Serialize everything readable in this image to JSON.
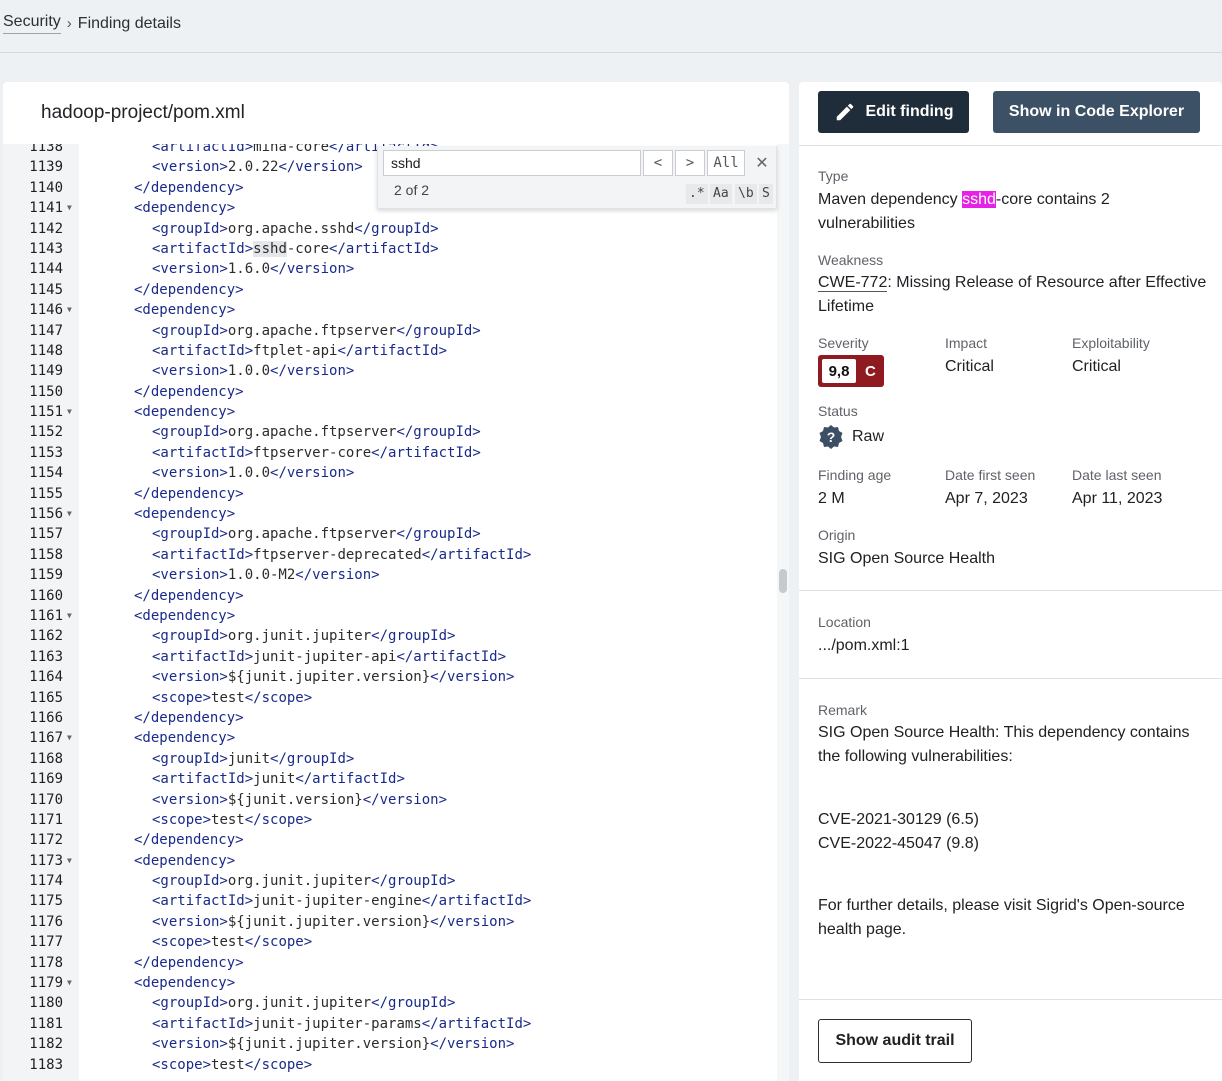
{
  "breadcrumb": {
    "parent": "Security",
    "current": "Finding details"
  },
  "file": {
    "path": "hadoop-project/pom.xml"
  },
  "search": {
    "query": "sshd",
    "prev_glyph": "<",
    "next_glyph": ">",
    "all_label": "All",
    "close_glyph": "✕",
    "match_count": "2 of 2",
    "opt_regex": ".*",
    "opt_case": "Aa",
    "opt_word": "\\b",
    "opt_selection": "S"
  },
  "code_lines": [
    {
      "n": "1138",
      "fold": false,
      "indent": 2,
      "parts": [
        [
          "tag",
          "<artifactId>"
        ],
        [
          "txt",
          "mina-core"
        ],
        [
          "tag",
          "</artifactId>"
        ]
      ]
    },
    {
      "n": "1139",
      "fold": false,
      "indent": 2,
      "parts": [
        [
          "tag",
          "<version>"
        ],
        [
          "txt",
          "2.0.22"
        ],
        [
          "tag",
          "</version>"
        ]
      ]
    },
    {
      "n": "1140",
      "fold": false,
      "indent": 1,
      "parts": [
        [
          "tag",
          "</dependency>"
        ]
      ]
    },
    {
      "n": "1141",
      "fold": true,
      "indent": 1,
      "parts": [
        [
          "tag",
          "<dependency>"
        ]
      ]
    },
    {
      "n": "1142",
      "fold": false,
      "indent": 2,
      "parts": [
        [
          "tag",
          "<groupId>"
        ],
        [
          "txt",
          "org.apache.sshd"
        ],
        [
          "tag",
          "</groupId>"
        ]
      ]
    },
    {
      "n": "1143",
      "fold": false,
      "indent": 2,
      "parts": [
        [
          "tag",
          "<artifactId>"
        ],
        [
          "hl",
          "sshd"
        ],
        [
          "txt",
          "-core"
        ],
        [
          "tag",
          "</artifactId>"
        ]
      ]
    },
    {
      "n": "1144",
      "fold": false,
      "indent": 2,
      "parts": [
        [
          "tag",
          "<version>"
        ],
        [
          "txt",
          "1.6.0"
        ],
        [
          "tag",
          "</version>"
        ]
      ]
    },
    {
      "n": "1145",
      "fold": false,
      "indent": 1,
      "parts": [
        [
          "tag",
          "</dependency>"
        ]
      ]
    },
    {
      "n": "1146",
      "fold": true,
      "indent": 1,
      "parts": [
        [
          "tag",
          "<dependency>"
        ]
      ]
    },
    {
      "n": "1147",
      "fold": false,
      "indent": 2,
      "parts": [
        [
          "tag",
          "<groupId>"
        ],
        [
          "txt",
          "org.apache.ftpserver"
        ],
        [
          "tag",
          "</groupId>"
        ]
      ]
    },
    {
      "n": "1148",
      "fold": false,
      "indent": 2,
      "parts": [
        [
          "tag",
          "<artifactId>"
        ],
        [
          "txt",
          "ftplet-api"
        ],
        [
          "tag",
          "</artifactId>"
        ]
      ]
    },
    {
      "n": "1149",
      "fold": false,
      "indent": 2,
      "parts": [
        [
          "tag",
          "<version>"
        ],
        [
          "txt",
          "1.0.0"
        ],
        [
          "tag",
          "</version>"
        ]
      ]
    },
    {
      "n": "1150",
      "fold": false,
      "indent": 1,
      "parts": [
        [
          "tag",
          "</dependency>"
        ]
      ]
    },
    {
      "n": "1151",
      "fold": true,
      "indent": 1,
      "parts": [
        [
          "tag",
          "<dependency>"
        ]
      ]
    },
    {
      "n": "1152",
      "fold": false,
      "indent": 2,
      "parts": [
        [
          "tag",
          "<groupId>"
        ],
        [
          "txt",
          "org.apache.ftpserver"
        ],
        [
          "tag",
          "</groupId>"
        ]
      ]
    },
    {
      "n": "1153",
      "fold": false,
      "indent": 2,
      "parts": [
        [
          "tag",
          "<artifactId>"
        ],
        [
          "txt",
          "ftpserver-core"
        ],
        [
          "tag",
          "</artifactId>"
        ]
      ]
    },
    {
      "n": "1154",
      "fold": false,
      "indent": 2,
      "parts": [
        [
          "tag",
          "<version>"
        ],
        [
          "txt",
          "1.0.0"
        ],
        [
          "tag",
          "</version>"
        ]
      ]
    },
    {
      "n": "1155",
      "fold": false,
      "indent": 1,
      "parts": [
        [
          "tag",
          "</dependency>"
        ]
      ]
    },
    {
      "n": "1156",
      "fold": true,
      "indent": 1,
      "parts": [
        [
          "tag",
          "<dependency>"
        ]
      ]
    },
    {
      "n": "1157",
      "fold": false,
      "indent": 2,
      "parts": [
        [
          "tag",
          "<groupId>"
        ],
        [
          "txt",
          "org.apache.ftpserver"
        ],
        [
          "tag",
          "</groupId>"
        ]
      ]
    },
    {
      "n": "1158",
      "fold": false,
      "indent": 2,
      "parts": [
        [
          "tag",
          "<artifactId>"
        ],
        [
          "txt",
          "ftpserver-deprecated"
        ],
        [
          "tag",
          "</artifactId>"
        ]
      ]
    },
    {
      "n": "1159",
      "fold": false,
      "indent": 2,
      "parts": [
        [
          "tag",
          "<version>"
        ],
        [
          "txt",
          "1.0.0-M2"
        ],
        [
          "tag",
          "</version>"
        ]
      ]
    },
    {
      "n": "1160",
      "fold": false,
      "indent": 1,
      "parts": [
        [
          "tag",
          "</dependency>"
        ]
      ]
    },
    {
      "n": "1161",
      "fold": true,
      "indent": 1,
      "parts": [
        [
          "tag",
          "<dependency>"
        ]
      ]
    },
    {
      "n": "1162",
      "fold": false,
      "indent": 2,
      "parts": [
        [
          "tag",
          "<groupId>"
        ],
        [
          "txt",
          "org.junit.jupiter"
        ],
        [
          "tag",
          "</groupId>"
        ]
      ]
    },
    {
      "n": "1163",
      "fold": false,
      "indent": 2,
      "parts": [
        [
          "tag",
          "<artifactId>"
        ],
        [
          "txt",
          "junit-jupiter-api"
        ],
        [
          "tag",
          "</artifactId>"
        ]
      ]
    },
    {
      "n": "1164",
      "fold": false,
      "indent": 2,
      "parts": [
        [
          "tag",
          "<version>"
        ],
        [
          "txt",
          "${junit.jupiter.version}"
        ],
        [
          "tag",
          "</version>"
        ]
      ]
    },
    {
      "n": "1165",
      "fold": false,
      "indent": 2,
      "parts": [
        [
          "tag",
          "<scope>"
        ],
        [
          "txt",
          "test"
        ],
        [
          "tag",
          "</scope>"
        ]
      ]
    },
    {
      "n": "1166",
      "fold": false,
      "indent": 1,
      "parts": [
        [
          "tag",
          "</dependency>"
        ]
      ]
    },
    {
      "n": "1167",
      "fold": true,
      "indent": 1,
      "parts": [
        [
          "tag",
          "<dependency>"
        ]
      ]
    },
    {
      "n": "1168",
      "fold": false,
      "indent": 2,
      "parts": [
        [
          "tag",
          "<groupId>"
        ],
        [
          "txt",
          "junit"
        ],
        [
          "tag",
          "</groupId>"
        ]
      ]
    },
    {
      "n": "1169",
      "fold": false,
      "indent": 2,
      "parts": [
        [
          "tag",
          "<artifactId>"
        ],
        [
          "txt",
          "junit"
        ],
        [
          "tag",
          "</artifactId>"
        ]
      ]
    },
    {
      "n": "1170",
      "fold": false,
      "indent": 2,
      "parts": [
        [
          "tag",
          "<version>"
        ],
        [
          "txt",
          "${junit.version}"
        ],
        [
          "tag",
          "</version>"
        ]
      ]
    },
    {
      "n": "1171",
      "fold": false,
      "indent": 2,
      "parts": [
        [
          "tag",
          "<scope>"
        ],
        [
          "txt",
          "test"
        ],
        [
          "tag",
          "</scope>"
        ]
      ]
    },
    {
      "n": "1172",
      "fold": false,
      "indent": 1,
      "parts": [
        [
          "tag",
          "</dependency>"
        ]
      ]
    },
    {
      "n": "1173",
      "fold": true,
      "indent": 1,
      "parts": [
        [
          "tag",
          "<dependency>"
        ]
      ]
    },
    {
      "n": "1174",
      "fold": false,
      "indent": 2,
      "parts": [
        [
          "tag",
          "<groupId>"
        ],
        [
          "txt",
          "org.junit.jupiter"
        ],
        [
          "tag",
          "</groupId>"
        ]
      ]
    },
    {
      "n": "1175",
      "fold": false,
      "indent": 2,
      "parts": [
        [
          "tag",
          "<artifactId>"
        ],
        [
          "txt",
          "junit-jupiter-engine"
        ],
        [
          "tag",
          "</artifactId>"
        ]
      ]
    },
    {
      "n": "1176",
      "fold": false,
      "indent": 2,
      "parts": [
        [
          "tag",
          "<version>"
        ],
        [
          "txt",
          "${junit.jupiter.version}"
        ],
        [
          "tag",
          "</version>"
        ]
      ]
    },
    {
      "n": "1177",
      "fold": false,
      "indent": 2,
      "parts": [
        [
          "tag",
          "<scope>"
        ],
        [
          "txt",
          "test"
        ],
        [
          "tag",
          "</scope>"
        ]
      ]
    },
    {
      "n": "1178",
      "fold": false,
      "indent": 1,
      "parts": [
        [
          "tag",
          "</dependency>"
        ]
      ]
    },
    {
      "n": "1179",
      "fold": true,
      "indent": 1,
      "parts": [
        [
          "tag",
          "<dependency>"
        ]
      ]
    },
    {
      "n": "1180",
      "fold": false,
      "indent": 2,
      "parts": [
        [
          "tag",
          "<groupId>"
        ],
        [
          "txt",
          "org.junit.jupiter"
        ],
        [
          "tag",
          "</groupId>"
        ]
      ]
    },
    {
      "n": "1181",
      "fold": false,
      "indent": 2,
      "parts": [
        [
          "tag",
          "<artifactId>"
        ],
        [
          "txt",
          "junit-jupiter-params"
        ],
        [
          "tag",
          "</artifactId>"
        ]
      ]
    },
    {
      "n": "1182",
      "fold": false,
      "indent": 2,
      "parts": [
        [
          "tag",
          "<version>"
        ],
        [
          "txt",
          "${junit.jupiter.version}"
        ],
        [
          "tag",
          "</version>"
        ]
      ]
    },
    {
      "n": "1183",
      "fold": false,
      "indent": 2,
      "parts": [
        [
          "tag",
          "<scope>"
        ],
        [
          "txt",
          "test"
        ],
        [
          "tag",
          "</scope>"
        ]
      ]
    }
  ],
  "actions": {
    "edit_label": "Edit finding",
    "explorer_label": "Show in Code Explorer",
    "audit_label": "Show audit trail"
  },
  "finding": {
    "type_label": "Type",
    "type_prefix": "Maven dependency ",
    "type_highlight": "sshd",
    "type_suffix": "-core contains 2 vulnerabilities",
    "weakness_label": "Weakness",
    "weakness_cwe": "CWE-772",
    "weakness_text": ": Missing Release of Resource after Effective Lifetime",
    "severity_label": "Severity",
    "severity_score": "9,8",
    "severity_letter": "C",
    "impact_label": "Impact",
    "impact_value": "Critical",
    "exploitability_label": "Exploitability",
    "exploitability_value": "Critical",
    "status_label": "Status",
    "status_value": "Raw",
    "age_label": "Finding age",
    "age_value": "2 M",
    "first_seen_label": "Date first seen",
    "first_seen_value": "Apr 7, 2023",
    "last_seen_label": "Date last seen",
    "last_seen_value": "Apr 11, 2023",
    "origin_label": "Origin",
    "origin_value": "SIG Open Source Health",
    "location_label": "Location",
    "location_value": ".../pom.xml:1",
    "remark_label": "Remark",
    "remark_intro": "SIG Open Source Health: This dependency contains the following vulnerabilities:",
    "remark_cve1": "CVE-2021-30129 (6.5)",
    "remark_cve2": "CVE-2022-45047 (9.8)",
    "remark_outro": "For further details, please visit Sigrid's Open-source health page."
  },
  "colors": {
    "severity_badge": "#8f1a1f",
    "edit_button": "#1f2d3a",
    "explorer_button": "#3c5166",
    "match_highlight": "#e622e6"
  }
}
